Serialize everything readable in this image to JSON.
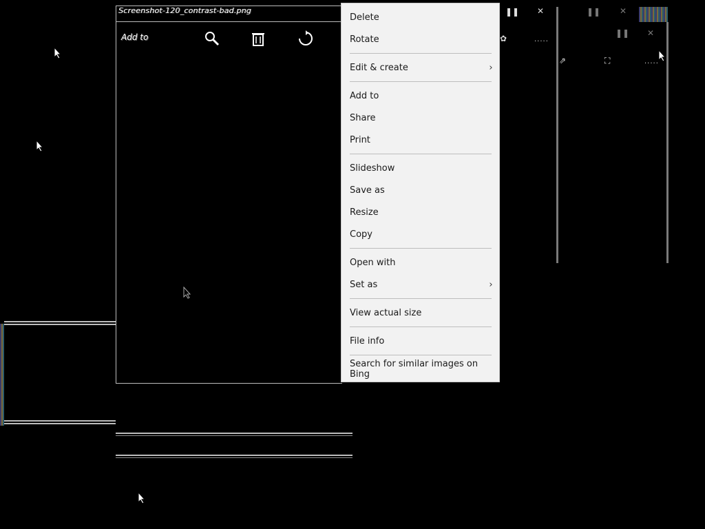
{
  "viewer": {
    "title": "Screenshot-120_contrast-bad.png",
    "toolbar_add_to": "Add to",
    "icons": [
      "zoom-icon",
      "delete-icon",
      "rotate-icon"
    ]
  },
  "menu": {
    "items": [
      {
        "label": "Delete"
      },
      {
        "label": "Rotate"
      },
      {
        "label": "Edit & create",
        "submenu": true
      },
      {
        "label": "Add to"
      },
      {
        "label": "Share"
      },
      {
        "label": "Print"
      },
      {
        "label": "Slideshow"
      },
      {
        "label": "Save as"
      },
      {
        "label": "Resize"
      },
      {
        "label": "Copy"
      },
      {
        "label": "Open with"
      },
      {
        "label": "Set as",
        "submenu": true
      },
      {
        "label": "View actual size"
      },
      {
        "label": "File info"
      },
      {
        "label": "Search for similar images on Bing"
      }
    ],
    "chevron": "›"
  },
  "colors": {
    "menu_bg": "#f2f2f2",
    "menu_text": "#1a1a1a",
    "desktop_bg": "#000000"
  }
}
